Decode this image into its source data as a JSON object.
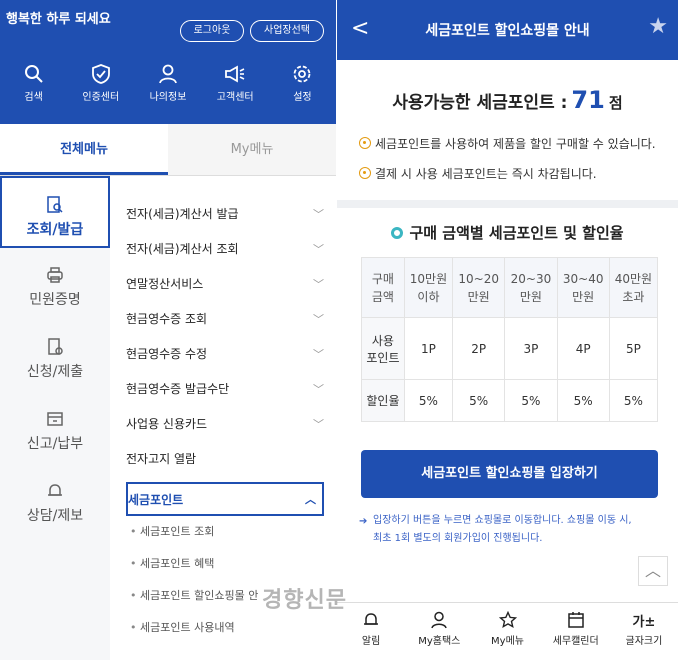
{
  "left": {
    "greeting": "행복한 하루 되세요",
    "logout_label": "로그아웃",
    "biz_select_label": "사업장선택",
    "top_icons": [
      {
        "label": "검색",
        "icon": "search-icon"
      },
      {
        "label": "인증센터",
        "icon": "shield-icon"
      },
      {
        "label": "나의정보",
        "icon": "person-icon"
      },
      {
        "label": "고객센터",
        "icon": "megaphone-icon"
      },
      {
        "label": "설정",
        "icon": "gear-icon"
      }
    ],
    "tabs": [
      {
        "label": "전체메뉴",
        "active": true
      },
      {
        "label": "My메뉴",
        "active": false
      }
    ],
    "side_categories": [
      {
        "label": "조회/발급",
        "icon": "search-doc-icon",
        "active": true
      },
      {
        "label": "민원증명",
        "icon": "printer-icon",
        "active": false
      },
      {
        "label": "신청/제출",
        "icon": "doc-pen-icon",
        "active": false
      },
      {
        "label": "신고/납부",
        "icon": "tray-icon",
        "active": false
      },
      {
        "label": "상담/제보",
        "icon": "bell-icon",
        "active": false
      }
    ],
    "menu_items": [
      {
        "label": "전자(세금)계산서 발급",
        "chevron": "down"
      },
      {
        "label": "전자(세금)계산서 조회",
        "chevron": "down"
      },
      {
        "label": "연말정산서비스",
        "chevron": "down"
      },
      {
        "label": "현금영수증 조회",
        "chevron": "down"
      },
      {
        "label": "현금영수증 수정",
        "chevron": "down"
      },
      {
        "label": "현금영수증 발급수단",
        "chevron": "down"
      },
      {
        "label": "사업용 신용카드",
        "chevron": "down"
      },
      {
        "label": "전자고지 열람",
        "chevron": ""
      }
    ],
    "selected_menu": {
      "label": "세금포인트",
      "chevron": "up"
    },
    "sub_items": [
      "세금포인트 조회",
      "세금포인트 혜택",
      "세금포인트 할인쇼핑몰 안",
      "세금포인트 사용내역"
    ]
  },
  "right": {
    "title": "세금포인트 할인쇼핑몰 안내",
    "points_label": "사용가능한 세금포인트 :",
    "points_value": "71",
    "points_unit": "점",
    "notice1": "세금포인트를 사용하여 제품을 할인 구매할 수 있습니다.",
    "notice2": "결제 시 사용 세금포인트는 즉시 차감됩니다.",
    "section_title": "구매 금액별 세금포인트 및 할인율",
    "table": {
      "header": [
        "구매\n금액",
        "10만원\n이하",
        "10~20\n만원",
        "20~30\n만원",
        "30~40\n만원",
        "40만원\n초과"
      ],
      "rows": [
        [
          "사용\n포인트",
          "1P",
          "2P",
          "3P",
          "4P",
          "5P"
        ],
        [
          "할인율",
          "5%",
          "5%",
          "5%",
          "5%",
          "5%"
        ]
      ]
    },
    "enter_button": "세금포인트 할인쇼핑몰 입장하기",
    "info_text": "입장하기 버튼을 누르면 쇼핑몰로 이동합니다. 쇼핑몰 이동 시, 최초 1회 별도의 회원가입이 진행됩니다.",
    "bottom_nav": [
      {
        "label": "알림",
        "icon": "bell-icon"
      },
      {
        "label": "My홈택스",
        "icon": "person-icon"
      },
      {
        "label": "My메뉴",
        "icon": "star-icon"
      },
      {
        "label": "세무캘린더",
        "icon": "calendar-icon"
      },
      {
        "label": "글자크기",
        "icon": "font-size-icon",
        "glyph": "가±"
      }
    ]
  },
  "watermark": "경향신문",
  "colors": {
    "primary": "#1f4fb1",
    "accent_orange": "#e49b12",
    "accent_teal": "#3bb6c2"
  }
}
